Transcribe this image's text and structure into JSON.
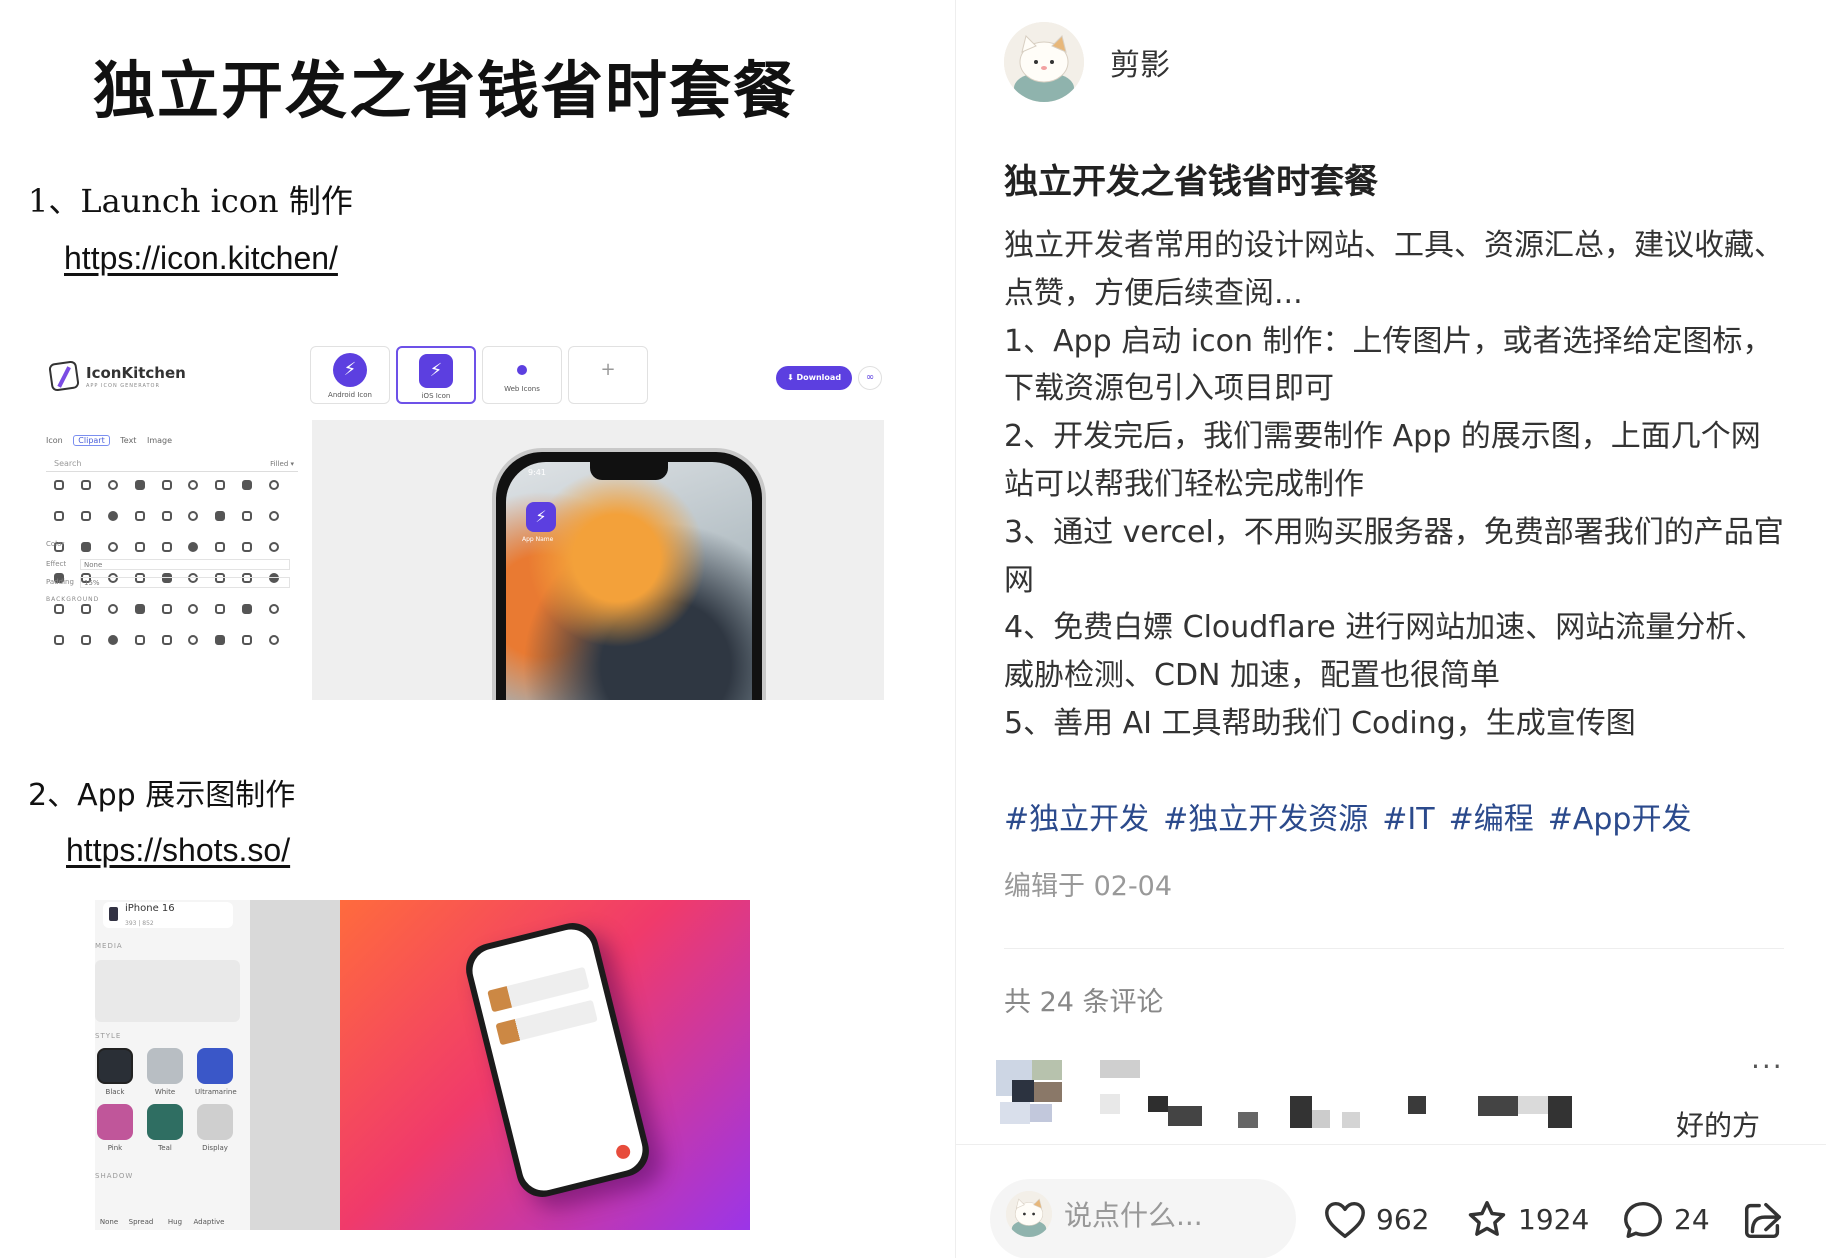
{
  "note_image": {
    "title": "独立开发之省钱省时套餐",
    "sections": [
      {
        "heading": "1、Launch icon 制作",
        "link": "https://icon.kitchen/"
      },
      {
        "heading": "2、App 展示图制作",
        "link": "https://shots.so/"
      }
    ],
    "iconkitchen": {
      "app_name": "IconKitchen",
      "app_subtitle": "APP ICON GENERATOR",
      "tabs": [
        "Icon",
        "Clipart",
        "Text",
        "Image"
      ],
      "search_placeholder": "Search",
      "filter": "Filled",
      "color_label": "Color",
      "effect_label": "Effect",
      "effect_value": "None",
      "padding_label": "Padding",
      "padding_value": "15%",
      "background_label": "BACKGROUND",
      "preview_cards": [
        "Android Icon",
        "iOS Icon",
        "Web Icons"
      ],
      "download_label": "Download",
      "phone_time": "9:41",
      "phone_app_name": "App Name"
    },
    "shots": {
      "device_name": "iPhone 16",
      "device_size": "393 | 852",
      "media_label": "MEDIA",
      "style_label": "STYLE",
      "swatches": [
        "Black",
        "White",
        "Ultramarine",
        "Pink",
        "Teal",
        "Display"
      ],
      "shadow_label": "SHADOW",
      "shadow_options": [
        "None",
        "Spread",
        "Hug",
        "Adaptive"
      ]
    }
  },
  "post": {
    "author": "剪影",
    "title": "独立开发之省钱省时套餐",
    "body": [
      "独立开发者常用的设计网站、工具、资源汇总，建议收藏、点赞，方便后续查阅...",
      "1、App 启动 icon 制作：上传图片，或者选择给定图标，下载资源包引入项目即可",
      "2、开发完后，我们需要制作 App 的展示图，上面几个网站可以帮我们轻松完成制作",
      "3、通过 vercel，不用购买服务器，免费部署我们的产品官网",
      "4、免费白嫖 Cloudflare 进行网站加速、网站流量分析、威胁检测、CDN 加速，配置也很简单",
      "5、善用 AI 工具帮助我们 Coding，生成宣传图"
    ],
    "tags": [
      "#独立开发",
      "#独立开发资源",
      "#IT",
      "#编程",
      "#App开发"
    ],
    "edit_time": "编辑于 02-04",
    "comment_count_text": "共 24 条评论",
    "first_comment_tail": "好的方",
    "more_icon": "···"
  },
  "bottom_bar": {
    "comment_placeholder": "说点什么...",
    "likes": "962",
    "favorites": "1924",
    "comments": "24"
  },
  "colors": {
    "accent_purple": "#5c3fe0",
    "tag_blue": "#2b4a8c",
    "muted_gray": "#999999"
  }
}
